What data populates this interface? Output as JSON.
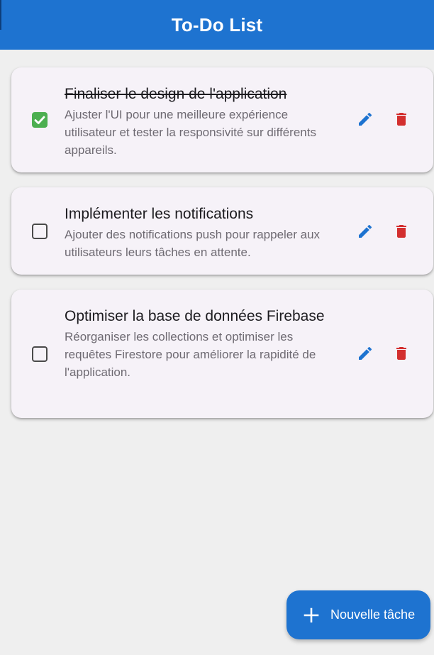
{
  "app_bar": {
    "title": "To-Do List"
  },
  "tasks": [
    {
      "title": "Finaliser le design de l'application",
      "description": "Ajuster l'UI pour une meilleure expérience utilisateur et tester la responsivité sur différents appareils.",
      "completed": true
    },
    {
      "title": "Implémenter les notifications",
      "description": "Ajouter des notifications push pour rappeler aux utilisateurs leurs tâches en attente.",
      "completed": false
    },
    {
      "title": "Optimiser la base de données Firebase",
      "description": "Réorganiser les collections et optimiser les requêtes Firestore pour améliorer la rapidité de l'application.",
      "completed": false
    }
  ],
  "fab": {
    "label": "Nouvelle tâche",
    "icon": "plus-icon"
  },
  "colors": {
    "primary": "#1e73d0",
    "checked": "#4caf50",
    "edit": "#1e73d0",
    "delete": "#d32f2f",
    "card_background": "#f6f2f8",
    "page_background": "#efefef"
  }
}
